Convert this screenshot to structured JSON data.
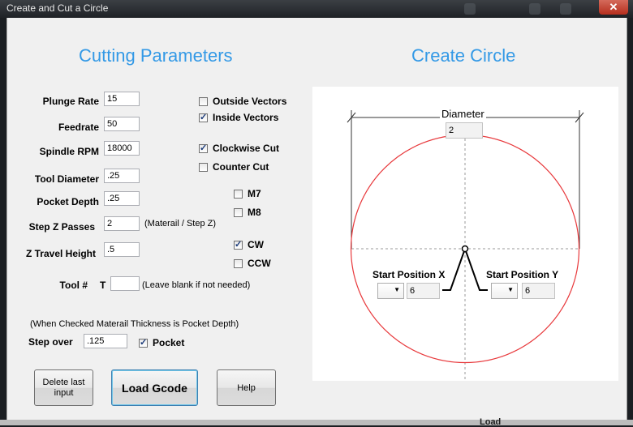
{
  "window": {
    "title": "Create and Cut a Circle",
    "close_glyph": "✕"
  },
  "headings": {
    "cutting": "Cutting Parameters",
    "circle": "Create Circle"
  },
  "params": {
    "plunge_rate": {
      "label": "Plunge Rate",
      "value": "15"
    },
    "feedrate": {
      "label": "Feedrate",
      "value": "50"
    },
    "spindle_rpm": {
      "label": "Spindle RPM",
      "value": "18000"
    },
    "tool_diameter": {
      "label": "Tool Diameter",
      "value": ".25"
    },
    "pocket_depth": {
      "label": "Pocket Depth",
      "value": ".25"
    },
    "step_z": {
      "label": "Step Z Passes",
      "value": "2",
      "note": "(Materail / Step Z)"
    },
    "z_travel": {
      "label": "Z Travel Height",
      "value": ".5"
    },
    "tool_num": {
      "label": "Tool #",
      "prefix": "T",
      "value": "",
      "note": "(Leave blank if not needed)"
    },
    "pocket_note": "(When Checked Materail Thickness is Pocket Depth)",
    "step_over": {
      "label": "Step over",
      "value": ".125"
    }
  },
  "checks": {
    "outside_vectors": {
      "label": "Outside Vectors",
      "checked": false
    },
    "inside_vectors": {
      "label": "Inside Vectors",
      "checked": true
    },
    "clockwise_cut": {
      "label": "Clockwise Cut",
      "checked": true
    },
    "counter_cut": {
      "label": "Counter Cut",
      "checked": false
    },
    "m7": {
      "label": "M7",
      "checked": false
    },
    "m8": {
      "label": "M8",
      "checked": false
    },
    "cw": {
      "label": "CW",
      "checked": true
    },
    "ccw": {
      "label": "CCW",
      "checked": false
    },
    "pocket": {
      "label": "Pocket",
      "checked": true
    }
  },
  "buttons": {
    "delete_last": "Delete last input",
    "load_gcode": "Load Gcode",
    "help": "Help"
  },
  "circle": {
    "diameter_label": "Diameter",
    "diameter_value": "2",
    "start_x_label": "Start Position X",
    "start_x_value": "6",
    "start_y_label": "Start Position Y",
    "start_y_value": "6",
    "circle_color": "#e8393c"
  },
  "background_fragment": "Load"
}
